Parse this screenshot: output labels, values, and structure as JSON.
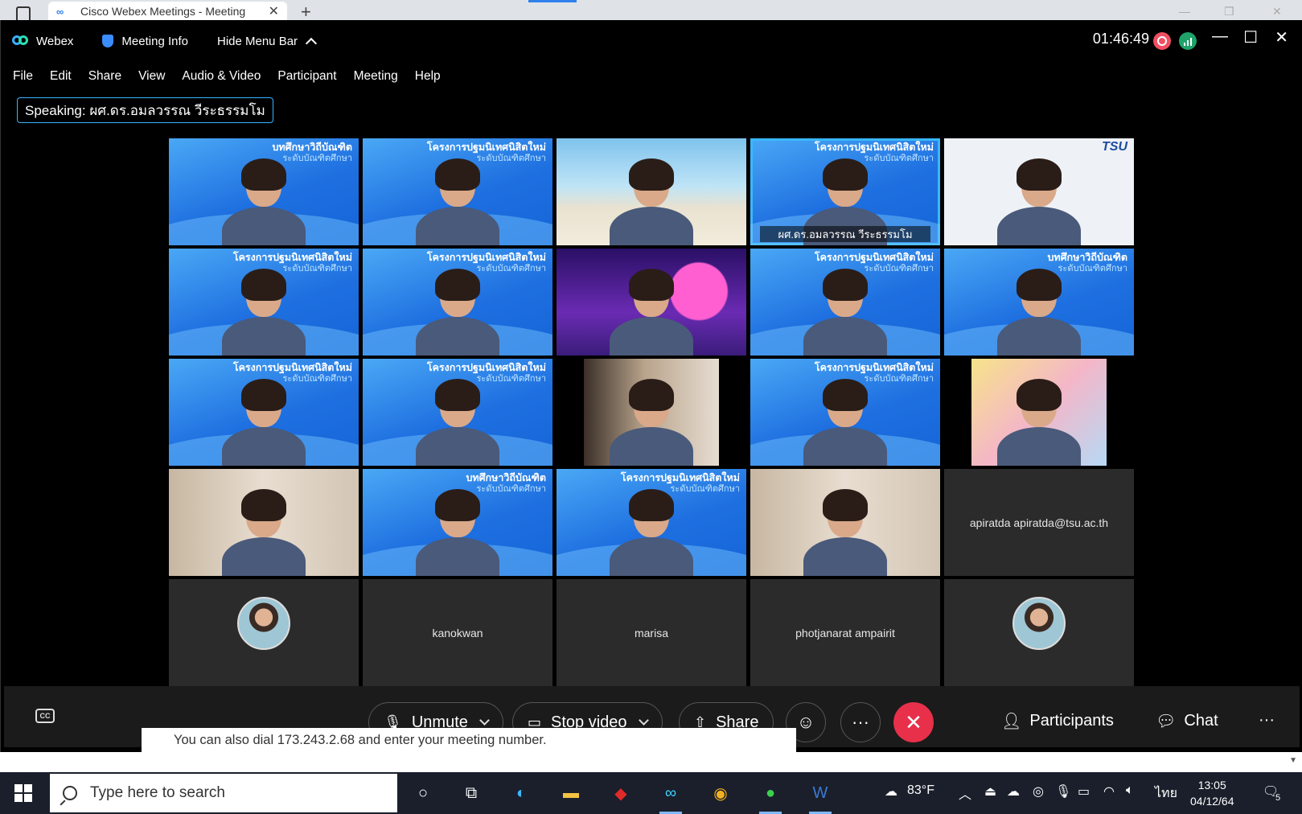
{
  "browser": {
    "tab_title": "Cisco Webex Meetings - Meeting",
    "tab_close": "✕",
    "new_tab": "+"
  },
  "titlebar": {
    "app_name": "Webex",
    "meeting_info": "Meeting Info",
    "hide_menu_bar": "Hide Menu Bar",
    "timer": "01:46:49"
  },
  "menu": [
    "File",
    "Edit",
    "Share",
    "View",
    "Audio & Video",
    "Participant",
    "Meeting",
    "Help"
  ],
  "speaking": "Speaking: ผศ.ดร.อมลวรรณ วีระธรรมโม",
  "tiles": [
    {
      "kind": "blue",
      "banner": "บทศึกษาวิถีบัณฑิต",
      "sub": "ระดับบัณฑิตศึกษา"
    },
    {
      "kind": "blue",
      "banner": "โครงการปฐมนิเทศนิสิตใหม่",
      "sub": "ระดับบัณฑิตศึกษา"
    },
    {
      "kind": "beach"
    },
    {
      "kind": "blue",
      "banner": "โครงการปฐมนิเทศนิสิตใหม่",
      "sub": "ระดับบัณฑิตศึกษา",
      "active": true,
      "name_tag": "ผศ.ดร.อมลวรรณ วีระธรรมโม"
    },
    {
      "kind": "tsu",
      "banner": "TSU"
    },
    {
      "kind": "blue",
      "banner": "โครงการปฐมนิเทศนิสิตใหม่",
      "sub": "ระดับบัณฑิตศึกษา"
    },
    {
      "kind": "blue",
      "banner": "โครงการปฐมนิเทศนิสิตใหม่",
      "sub": "ระดับบัณฑิตศึกษา"
    },
    {
      "kind": "purple"
    },
    {
      "kind": "blue",
      "banner": "โครงการปฐมนิเทศนิสิตใหม่",
      "sub": "ระดับบัณฑิตศึกษา"
    },
    {
      "kind": "blue",
      "banner": "บทศึกษาวิถีบัณฑิต",
      "sub": "ระดับบัณฑิตศึกษา"
    },
    {
      "kind": "blue",
      "banner": "โครงการปฐมนิเทศนิสิตใหม่",
      "sub": "ระดับบัณฑิตศึกษา"
    },
    {
      "kind": "blue",
      "banner": "โครงการปฐมนิเทศนิสิตใหม่",
      "sub": "ระดับบัณฑิตศึกษา"
    },
    {
      "kind": "black",
      "inset": "room"
    },
    {
      "kind": "blue",
      "banner": "โครงการปฐมนิเทศนิสิตใหม่",
      "sub": "ระดับบัณฑิตศึกษา"
    },
    {
      "kind": "black",
      "inset": "pastel"
    },
    {
      "kind": "room"
    },
    {
      "kind": "blue",
      "banner": "บทศึกษาวิถีบัณฑิต",
      "sub": "ระดับบัณฑิตศึกษา"
    },
    {
      "kind": "blue",
      "banner": "โครงการปฐมนิเทศนิสิตใหม่",
      "sub": "ระดับบัณฑิตศึกษา"
    },
    {
      "kind": "room"
    },
    {
      "kind": "dark",
      "label": "apiratda apiratda@tsu.ac.th"
    },
    {
      "kind": "dark",
      "avatar": true
    },
    {
      "kind": "dark",
      "label": "kanokwan"
    },
    {
      "kind": "dark",
      "label": "marisa"
    },
    {
      "kind": "dark",
      "label": "photjanarat ampairit"
    },
    {
      "kind": "dark",
      "avatar": true
    }
  ],
  "controls": {
    "cc": "CC",
    "unmute": "Unmute",
    "stop_video": "Stop video",
    "share": "Share",
    "reactions": "☺",
    "more": "···",
    "end": "✕",
    "participants": "Participants",
    "chat": "Chat",
    "overflow": "···"
  },
  "dial_text": "You can also dial 173.243.2.68 and enter your meeting number.",
  "taskbar": {
    "search_placeholder": "Type here to search",
    "weather": "83°F",
    "lang": "ไทย",
    "time": "13:05",
    "date": "04/12/64",
    "notifications": "5"
  },
  "colors": {
    "accent": "#39b8ff",
    "end_call": "#e8304a",
    "recording": "#f04f62",
    "stats": "#1fa36b"
  }
}
